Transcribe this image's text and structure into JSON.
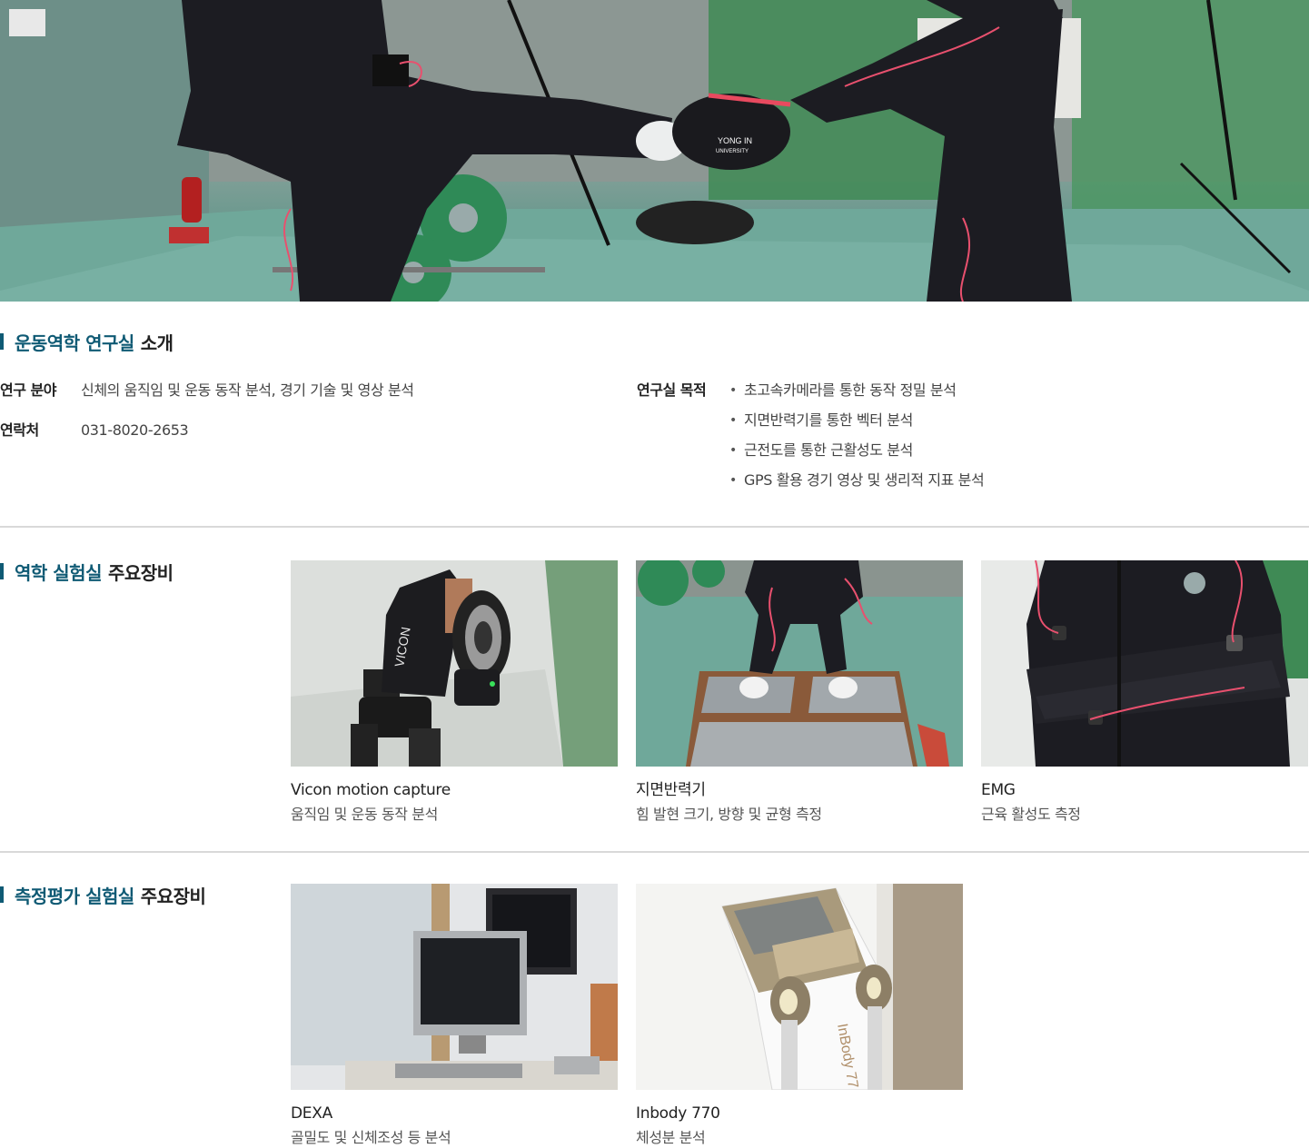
{
  "hero": {
    "image_name": "motion-capture-kick-photo",
    "pad_text_line1": "YONG IN",
    "pad_text_line2": "UNIVERSITY"
  },
  "intro": {
    "title_accent": "운동역학 연구실",
    "title_rest": "소개",
    "field_label": "연구 분야",
    "field_value": "신체의 움직임 및 운동 동작 분석, 경기 기술 및 영상 분석",
    "contact_label": "연락처",
    "contact_value": "031-8020-2653",
    "purpose_label": "연구실 목적",
    "purpose_items": [
      "초고속카메라를 통한 동작 정밀 분석",
      "지면반력기를 통한 벡터 분석",
      "근전도를 통한 근활성도 분석",
      "GPS 활용 경기 영상 및 생리적 지표 분석"
    ]
  },
  "biomech_lab": {
    "title_accent": "역학 실험실",
    "title_rest": "주요장비",
    "items": [
      {
        "name": "Vicon motion capture",
        "desc": "움직임 및 운동 동작 분석",
        "camera_brand": "VICON"
      },
      {
        "name": "지면반력기",
        "desc": "힘 발현 크기, 방향 및 균형 측정"
      },
      {
        "name": "EMG",
        "desc": "근육 활성도 측정"
      }
    ]
  },
  "measure_lab": {
    "title_accent": "측정평가 실험실",
    "title_rest": "주요장비",
    "items": [
      {
        "name": "DEXA",
        "desc": "골밀도 및 신체조성 등 분석"
      },
      {
        "name": "Inbody 770",
        "desc": "체성분 분석",
        "device_text": "InBody 77"
      }
    ]
  },
  "colors": {
    "accent": "#0f5a74",
    "divider": "#d9d9d9",
    "suit": "#1c1c22",
    "floor": "#6fa89a",
    "plate_green": "#2f8a57",
    "emg_wire": "#e8506e"
  }
}
